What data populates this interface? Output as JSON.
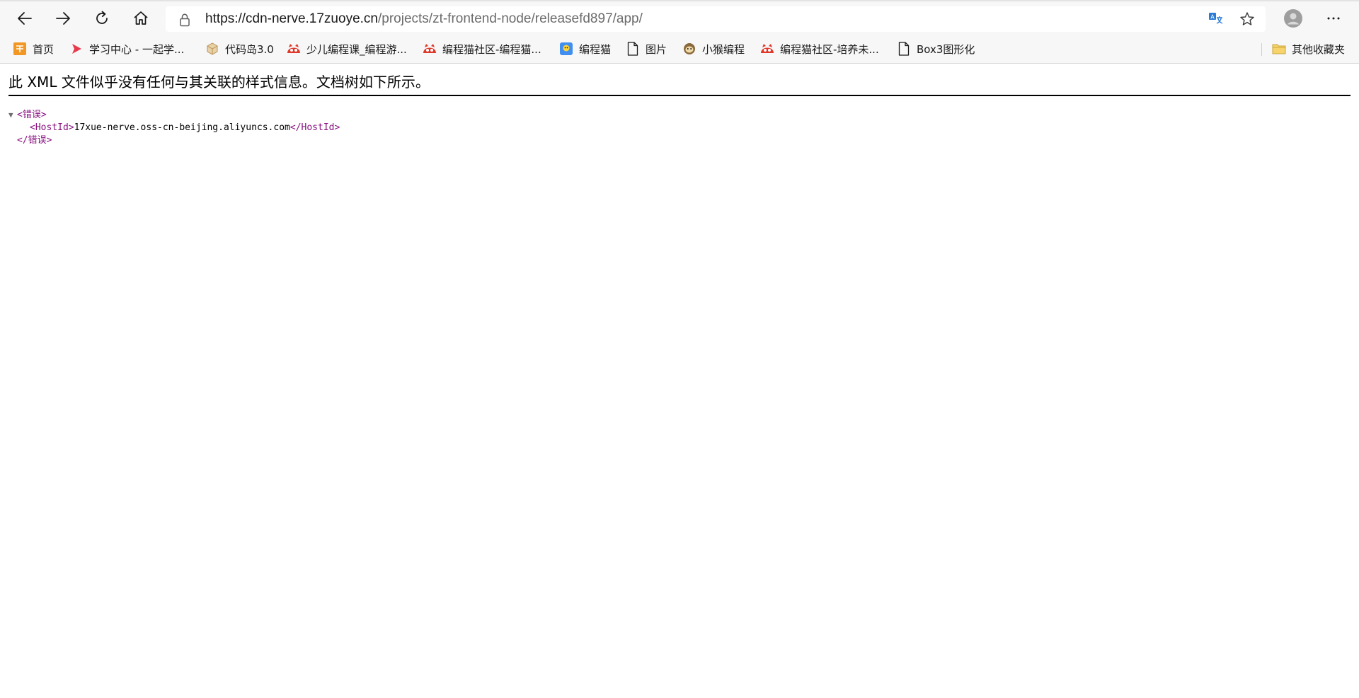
{
  "browser": {
    "address": {
      "host": "https://cdn-nerve.17zuoye.cn",
      "path": "/projects/zt-frontend-node/releasefd897/app/"
    },
    "colors": {
      "toolbar_bg": "#f7f7f7",
      "xml_tag": "#881280"
    }
  },
  "bookmarks": {
    "items": [
      {
        "label": "首页",
        "icon": "homepage-favicon"
      },
      {
        "label": "学习中心 - 一起学...",
        "icon": "play-favicon"
      },
      {
        "label": "代码岛3.0",
        "icon": "cube-favicon"
      },
      {
        "label": "少儿编程课_编程游...",
        "icon": "codemao-favicon"
      },
      {
        "label": "编程猫社区-编程猫...",
        "icon": "codemao-favicon"
      },
      {
        "label": "编程猫",
        "icon": "codemao-app-favicon"
      },
      {
        "label": "图片",
        "icon": "page-icon"
      },
      {
        "label": "小猴编程",
        "icon": "monkey-favicon"
      },
      {
        "label": "编程猫社区-培养未...",
        "icon": "codemao-favicon"
      },
      {
        "label": "Box3图形化",
        "icon": "page-icon"
      }
    ],
    "other": {
      "label": "其他收藏夹",
      "icon": "folder-icon"
    }
  },
  "page": {
    "header": "此 XML 文件似乎没有任何与其关联的样式信息。文档树如下所示。",
    "xml": {
      "root_open": "<错误>",
      "child_open": "<HostId>",
      "child_text": "17xue-nerve.oss-cn-beijing.aliyuncs.com",
      "child_close": "</HostId>",
      "root_close": "</错误>",
      "toggle_glyph": "▼"
    }
  }
}
